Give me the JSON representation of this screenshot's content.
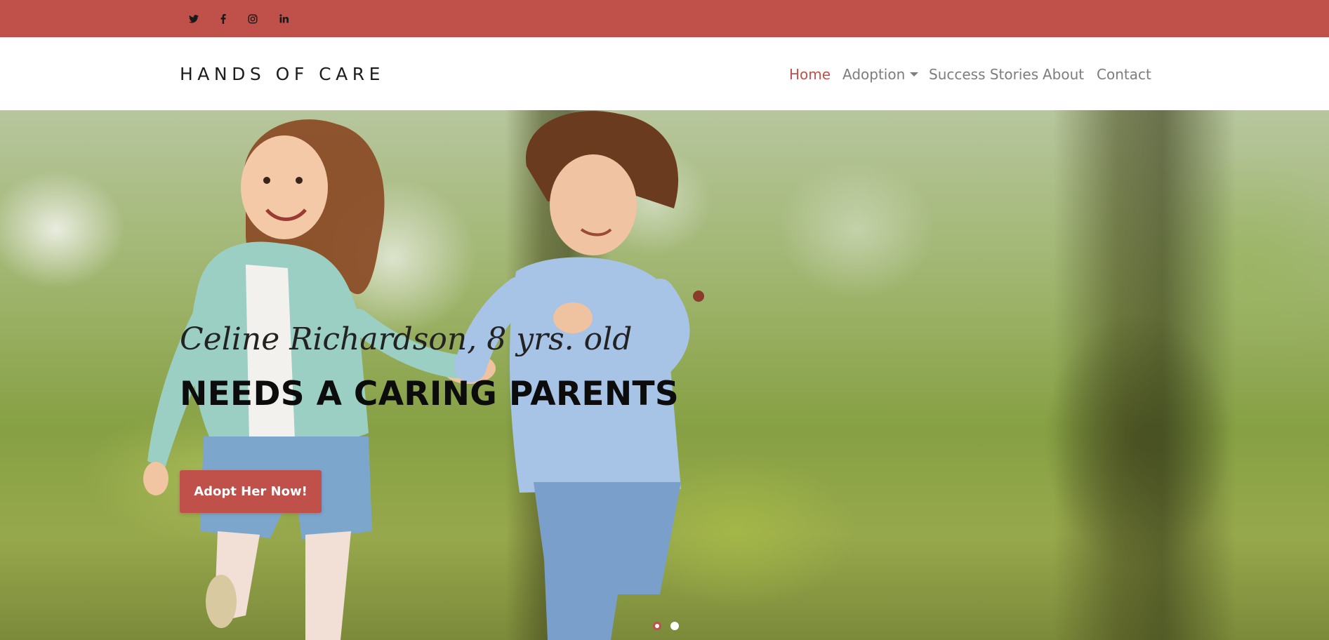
{
  "colors": {
    "accent": "#c0504a",
    "nav_text": "#7d7d7d",
    "brand_text": "#1d1d1d"
  },
  "social_links": [
    {
      "icon": "twitter-icon"
    },
    {
      "icon": "facebook-icon"
    },
    {
      "icon": "instagram-icon"
    },
    {
      "icon": "linkedin-icon"
    }
  ],
  "header": {
    "brand": "HANDS OF CARE"
  },
  "nav": {
    "items": [
      {
        "label": "Home",
        "active": true
      },
      {
        "label": "Adoption",
        "dropdown": true
      },
      {
        "label": "Success Stories"
      },
      {
        "label": "About"
      },
      {
        "label": "Contact"
      }
    ]
  },
  "hero": {
    "subtitle": "Celine Richardson, 8 yrs. old",
    "title": "NEEDS A CARING PARENTS",
    "cta_label": "Adopt Her Now!",
    "slides_total": 2,
    "active_slide": 1
  }
}
